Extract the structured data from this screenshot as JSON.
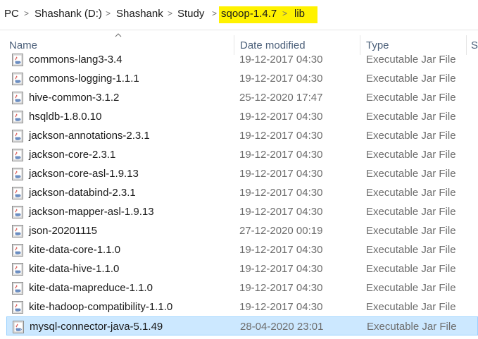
{
  "breadcrumb": {
    "items": [
      "PC",
      "Shashank (D:)",
      "Shashank",
      "Study",
      "sqoop-1.4.7",
      "lib"
    ],
    "separator": ">",
    "highlight_color": "#fff200"
  },
  "columns": {
    "name": "Name",
    "date_modified": "Date modified",
    "type": "Type",
    "size": "S"
  },
  "files": [
    {
      "name": "commons-lang3-3.4",
      "date": "19-12-2017 04:30",
      "type": "Executable Jar File"
    },
    {
      "name": "commons-logging-1.1.1",
      "date": "19-12-2017 04:30",
      "type": "Executable Jar File"
    },
    {
      "name": "hive-common-3.1.2",
      "date": "25-12-2020 17:47",
      "type": "Executable Jar File"
    },
    {
      "name": "hsqldb-1.8.0.10",
      "date": "19-12-2017 04:30",
      "type": "Executable Jar File"
    },
    {
      "name": "jackson-annotations-2.3.1",
      "date": "19-12-2017 04:30",
      "type": "Executable Jar File"
    },
    {
      "name": "jackson-core-2.3.1",
      "date": "19-12-2017 04:30",
      "type": "Executable Jar File"
    },
    {
      "name": "jackson-core-asl-1.9.13",
      "date": "19-12-2017 04:30",
      "type": "Executable Jar File"
    },
    {
      "name": "jackson-databind-2.3.1",
      "date": "19-12-2017 04:30",
      "type": "Executable Jar File"
    },
    {
      "name": "jackson-mapper-asl-1.9.13",
      "date": "19-12-2017 04:30",
      "type": "Executable Jar File"
    },
    {
      "name": "json-20201115",
      "date": "27-12-2020 00:19",
      "type": "Executable Jar File"
    },
    {
      "name": "kite-data-core-1.1.0",
      "date": "19-12-2017 04:30",
      "type": "Executable Jar File"
    },
    {
      "name": "kite-data-hive-1.1.0",
      "date": "19-12-2017 04:30",
      "type": "Executable Jar File"
    },
    {
      "name": "kite-data-mapreduce-1.1.0",
      "date": "19-12-2017 04:30",
      "type": "Executable Jar File"
    },
    {
      "name": "kite-hadoop-compatibility-1.1.0",
      "date": "19-12-2017 04:30",
      "type": "Executable Jar File"
    },
    {
      "name": "mysql-connector-java-5.1.49",
      "date": "28-04-2020 23:01",
      "type": "Executable Jar File",
      "selected": true
    }
  ],
  "icons": {
    "file": "jar-file-icon",
    "sort": "sort-up-icon",
    "separator": "chevron-right-icon"
  },
  "colors": {
    "selection_bg": "#cce8ff",
    "header_text": "#4c607a"
  }
}
